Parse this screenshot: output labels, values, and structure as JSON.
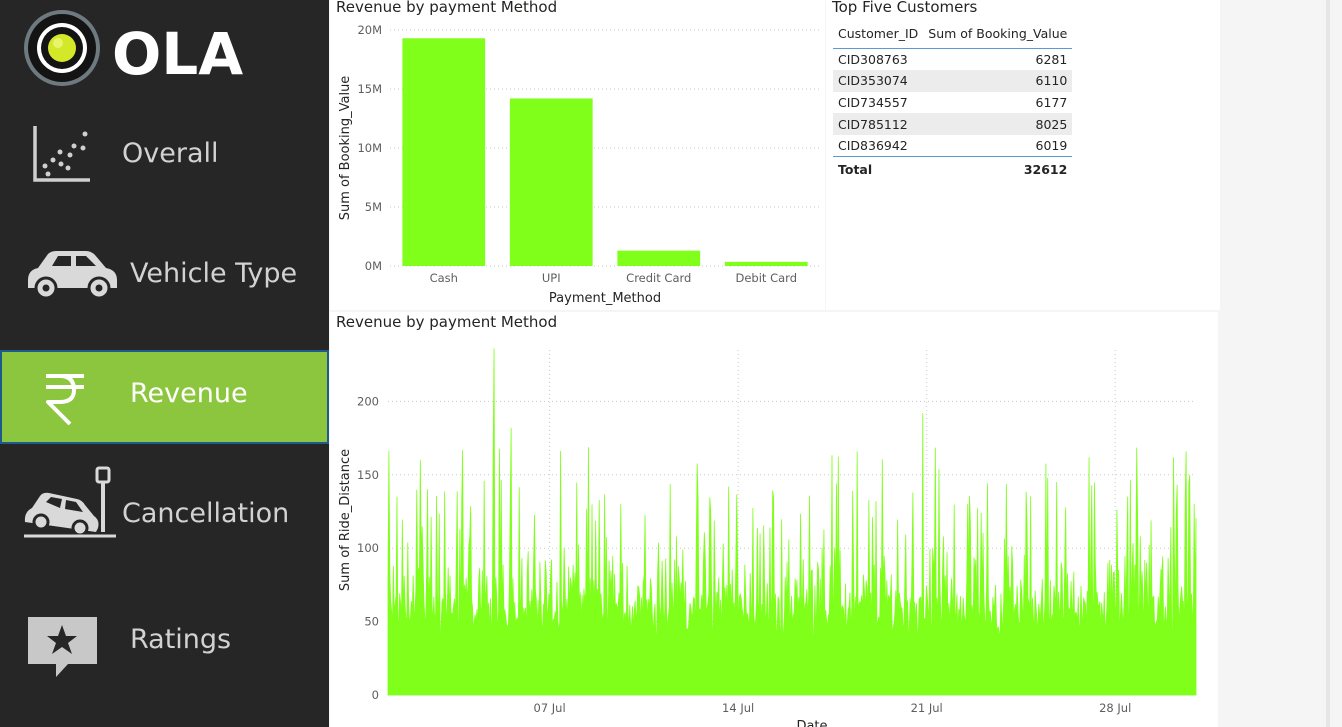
{
  "sidebar": {
    "logo": {
      "text": "OLA"
    },
    "items": [
      {
        "label": "Overall",
        "icon": "scatter-chart-icon",
        "active": false
      },
      {
        "label": "Vehicle Type",
        "icon": "car-icon",
        "active": false
      },
      {
        "label": "Revenue",
        "icon": "rupee-icon",
        "active": true
      },
      {
        "label": "Cancellation",
        "icon": "car-crash-icon",
        "active": false
      },
      {
        "label": "Ratings",
        "icon": "star-message-icon",
        "active": false
      }
    ]
  },
  "colors": {
    "accent": "#7fff1a",
    "nav_active": "#8cc63f",
    "sidebar": "#262626"
  },
  "top_chart": {
    "title": "Revenue by payment Method"
  },
  "top_customers": {
    "title": "Top Five Customers",
    "columns": [
      "Customer_ID",
      "Sum of Booking_Value"
    ],
    "rows": [
      [
        "CID308763",
        "6281"
      ],
      [
        "CID353074",
        "6110"
      ],
      [
        "CID734557",
        "6177"
      ],
      [
        "CID785112",
        "8025"
      ],
      [
        "CID836942",
        "6019"
      ]
    ],
    "total": [
      "Total",
      "32612"
    ]
  },
  "bottom_chart": {
    "title": "Revenue by payment Method"
  },
  "chart_data": [
    {
      "type": "bar",
      "title": "Revenue by payment Method",
      "categories": [
        "Cash",
        "UPI",
        "Credit Card",
        "Debit Card"
      ],
      "values": [
        19300000,
        14200000,
        1300000,
        350000
      ],
      "xlabel": "Payment_Method",
      "ylabel": "Sum of Booking_Value",
      "ylim": [
        0,
        20000000
      ],
      "yticks": [
        0,
        5000000,
        10000000,
        15000000,
        20000000
      ],
      "ytick_labels": [
        "0M",
        "5M",
        "10M",
        "15M",
        "20M"
      ],
      "color": "#7fff1a",
      "grid": true
    },
    {
      "type": "area",
      "title": "Revenue by payment Method",
      "xlabel": "Date",
      "ylabel": "Sum of Ride_Distance",
      "ylim": [
        0,
        235
      ],
      "yticks": [
        0,
        50,
        100,
        150,
        200
      ],
      "x_range": [
        "2024-07-01",
        "2024-07-31"
      ],
      "xtick_labels": [
        "07 Jul",
        "14 Jul",
        "21 Jul",
        "28 Jul"
      ],
      "baseline": 40,
      "max": 236,
      "color": "#7fff1a",
      "grid": true
    }
  ]
}
